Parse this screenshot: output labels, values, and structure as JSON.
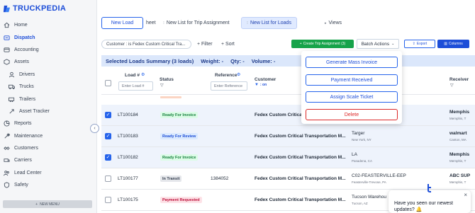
{
  "app": {
    "name": "TRUCKPEDIA",
    "accent": "#1d4ed8"
  },
  "sidebar": {
    "items": [
      {
        "label": "Home",
        "icon": "home-icon"
      },
      {
        "label": "Dispatch",
        "icon": "dispatch-icon",
        "active": true
      },
      {
        "label": "Accounting",
        "icon": "accounting-icon"
      },
      {
        "label": "Assets",
        "icon": "assets-icon"
      },
      {
        "label": "Drivers",
        "icon": "driver-icon",
        "sub": true
      },
      {
        "label": "Trucks",
        "icon": "truck-icon",
        "sub": true
      },
      {
        "label": "Trailers",
        "icon": "trailer-icon",
        "sub": true
      },
      {
        "label": "Asset Tracker",
        "icon": "tracker-icon",
        "sub": true
      },
      {
        "label": "Reports",
        "icon": "reports-icon"
      },
      {
        "label": "Maintenance",
        "icon": "maintenance-icon"
      },
      {
        "label": "Customers",
        "icon": "customers-icon"
      },
      {
        "label": "Carriers",
        "icon": "carriers-icon"
      },
      {
        "label": "Lead Center",
        "icon": "lead-center-icon"
      },
      {
        "label": "Safety",
        "icon": "safety-icon"
      }
    ],
    "new_menu": "NEW MENU"
  },
  "tabs": {
    "new_load": "New Load",
    "cut_tab": "heet",
    "trip_assignment": "New List for Trip Assignment",
    "invoice": "New List for Loads",
    "views": "Views"
  },
  "toolbar": {
    "filter_pill": "Customer : is Fedex Custom Critical Tra...",
    "filter": "+ Filter",
    "sort": "+ Sort",
    "create_trip": "Create Trip Assignment (3)",
    "batch_actions": "Batch Actions",
    "export": "Export",
    "columns": "Columns"
  },
  "summary": {
    "title": "Selected Loads Summary (3 loads)",
    "weight": "Weight: -",
    "qty": "Qty: -",
    "volume": "Volume: -"
  },
  "table": {
    "headers": {
      "load": "Load #",
      "status": "Status",
      "reference": "Reference",
      "customer": "Customer",
      "customer_sub": ": on",
      "receiver": "Receiver"
    },
    "placeholders": {
      "load": "Enter Load #",
      "reference": "Enter Reference"
    },
    "rows": [
      {
        "load": "LT100184",
        "status": "Ready For Invoice",
        "status_type": "invoice",
        "reference": "",
        "customer": "Fedex Custom Critical",
        "shipper": "",
        "shipper_loc": "",
        "receiver": "Memphis",
        "receiver_loc": "Memphis, T",
        "checked": true
      },
      {
        "load": "LT100183",
        "status": "Ready For Review",
        "status_type": "review",
        "reference": "",
        "customer": "Fedex Custom Critical Transportation M...",
        "shipper": "Targer",
        "shipper_loc": "New York, NY",
        "receiver": "walmart",
        "receiver_loc": "Canton, MA",
        "checked": true
      },
      {
        "load": "LT100182",
        "status": "Ready For Invoice",
        "status_type": "invoice",
        "reference": "",
        "customer": "Fedex Custom Critical Transportation M...",
        "shipper": "LA",
        "shipper_loc": "Pasadena, CA",
        "receiver": "Memphis",
        "receiver_loc": "Memphis, T",
        "checked": true
      },
      {
        "load": "LT100177",
        "status": "In Transit",
        "status_type": "transit",
        "reference": "1384052",
        "customer": "Fedex Custom Critical Transportation M...",
        "shipper": "C02-FEASTERVILLE-EEP",
        "shipper_loc": "Feasterville-Trevose, PA",
        "receiver": "ABC SUP",
        "receiver_loc": "Memphis, T",
        "checked": false
      },
      {
        "load": "LT100175",
        "status": "Payment Requested",
        "status_type": "payment",
        "reference": "",
        "customer": "Fedex Custom Critical Transportation M...",
        "shipper": "Tucson Warehou",
        "shipper_loc": "Tucson, AZ",
        "receiver": "",
        "receiver_loc": "",
        "checked": false
      }
    ]
  },
  "batch_menu": {
    "items": [
      "Generate Mass Invoice",
      "Payment Received",
      "Assign Scale Ticket",
      "Delete"
    ]
  },
  "chat": {
    "message": "Have you seen our newest updates?",
    "emoji": "🔔"
  },
  "colors": {
    "primary": "#1d4ed8",
    "success": "#16a34a",
    "danger": "#dc2626",
    "summary_bg": "#dbe7fb"
  }
}
